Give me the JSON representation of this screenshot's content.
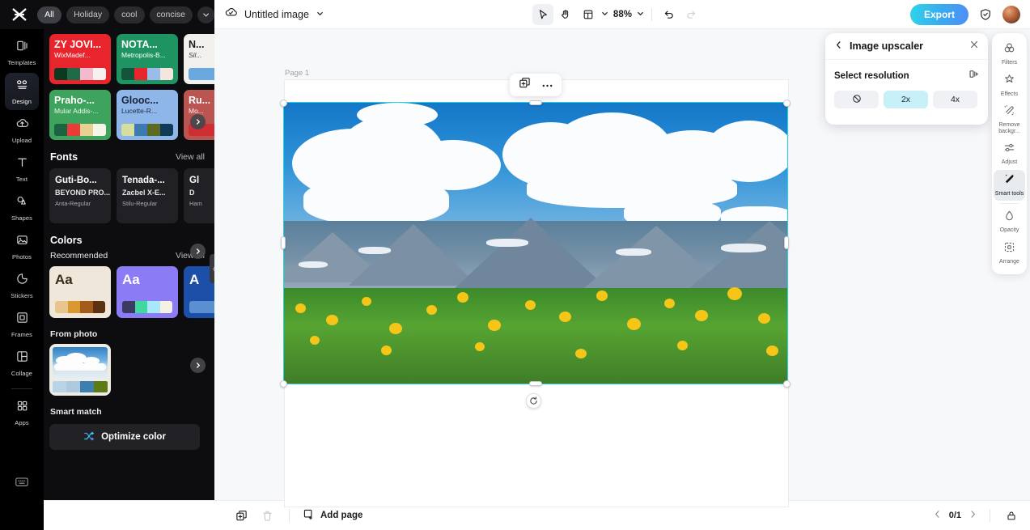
{
  "topbar": {
    "logo_icon": "capcut-logo-icon",
    "chips": [
      {
        "label": "All",
        "active": true
      },
      {
        "label": "Holiday",
        "active": false
      },
      {
        "label": "cool",
        "active": false
      },
      {
        "label": "concise",
        "active": false
      }
    ],
    "chip_more_icon": "chevron-down-icon",
    "cloud_icon": "cloud-saved-icon",
    "doc_title": "Untitled image",
    "doc_caret_icon": "chevron-down-icon",
    "tools": [
      {
        "name": "select-tool",
        "icon": "cursor-icon",
        "selected": true
      },
      {
        "name": "hand-tool",
        "icon": "hand-icon",
        "selected": false
      },
      {
        "name": "layout-tool",
        "icon": "layout-icon",
        "selected": false
      }
    ],
    "zoom_level": "88%",
    "undo_icon": "undo-icon",
    "redo_icon": "redo-icon",
    "export_label": "Export",
    "shield_icon": "shield-check-icon",
    "avatar_name": "user-avatar"
  },
  "rail": {
    "items": [
      {
        "label": "Templates",
        "icon": "templates-icon",
        "active": false
      },
      {
        "label": "Design",
        "icon": "design-icon",
        "active": true
      },
      {
        "label": "Upload",
        "icon": "upload-cloud-icon",
        "active": false
      },
      {
        "label": "Text",
        "icon": "text-icon",
        "active": false
      },
      {
        "label": "Shapes",
        "icon": "shapes-icon",
        "active": false
      },
      {
        "label": "Photos",
        "icon": "photos-icon",
        "active": false
      },
      {
        "label": "Stickers",
        "icon": "stickers-icon",
        "active": false
      },
      {
        "label": "Frames",
        "icon": "frames-icon",
        "active": false
      },
      {
        "label": "Collage",
        "icon": "collage-icon",
        "active": false
      },
      {
        "label": "Apps",
        "icon": "apps-grid-icon",
        "active": false
      }
    ],
    "bottom_icon": "keyboard-shortcuts-icon"
  },
  "panel": {
    "templates": [
      {
        "title": "ZY JOVI...",
        "subtitle": "WixMadef...",
        "bg": "#e8242c",
        "title_color": "#ffffff",
        "sub_color": "#ffffff",
        "swatches": [
          "#0c3a21",
          "#1f6b45",
          "#f4b9cd",
          "#f6f1ee"
        ]
      },
      {
        "title": "NOTA...",
        "subtitle": "Metropolis-B...",
        "bg": "#1f9463",
        "title_color": "#ffffff",
        "sub_color": "#ffffff",
        "swatches": [
          "#13553a",
          "#e8242c",
          "#9bbbe8",
          "#f4e6dc"
        ]
      },
      {
        "title": "N...",
        "subtitle": "Sil...",
        "bg": "#f2f0ec",
        "title_color": "#1c1c20",
        "sub_color": "#3a3a40",
        "swatches": [
          "#6aa9e0",
          "#6aa9e0",
          "#6aa9e0",
          "#6aa9e0"
        ]
      },
      {
        "title": "Praho-...",
        "subtitle": "Mular Addis-...",
        "bg": "#3da35d",
        "title_color": "#ffffff",
        "sub_color": "#eef6ee",
        "swatches": [
          "#1b6341",
          "#ea3b39",
          "#e8d190",
          "#f5f4e8"
        ]
      },
      {
        "title": "Glooc...",
        "subtitle": "Lucette-R...",
        "bg": "#8fb6e8",
        "title_color": "#16233c",
        "sub_color": "#1d2c48",
        "swatches": [
          "#d6dfa0",
          "#3d7ab2",
          "#5c6a22",
          "#123a56"
        ]
      },
      {
        "title": "Ru...",
        "subtitle": "Mo...",
        "bg": "#bb5552",
        "title_color": "#ffffff",
        "sub_color": "#ffeeee",
        "swatches": [
          "#cf2f33",
          "#cf2f33",
          "#cf2f33",
          "#cf2f33"
        ]
      }
    ],
    "fonts_section": {
      "title": "Fonts",
      "view_all": "View all"
    },
    "fonts": [
      {
        "line1": "Guti-Bo...",
        "line2": "BEYOND PRO...",
        "line3": "Anta-Regular"
      },
      {
        "line1": "Tenada-...",
        "line2": "Zacbel X-E...",
        "line3": "Stilu-Regular"
      },
      {
        "line1": "Gl",
        "line2": "D",
        "line3": "Ham"
      }
    ],
    "colors_section": {
      "title": "Colors",
      "sub": "Recommended",
      "view_all": "View all"
    },
    "colors": [
      {
        "sample": "Aa",
        "bg": "#efe7d9",
        "fg": "#3b2a17",
        "swatches": [
          "#e8c58f",
          "#d9992f",
          "#a35c19",
          "#5d3210"
        ]
      },
      {
        "sample": "Aa",
        "bg": "#8b7cf6",
        "fg": "#ffffff",
        "swatches": [
          "#3b3a63",
          "#3fd9a0",
          "#a9e8f8",
          "#f4f1e4"
        ]
      },
      {
        "sample": "A",
        "bg": "#1b4fa8",
        "fg": "#ffffff",
        "swatches": [
          "#5a8fd1",
          "#5a8fd1",
          "#5a8fd1",
          "#5a8fd1"
        ]
      }
    ],
    "from_photo_label": "From photo",
    "photo_swatches": [
      "#b9d4e6",
      "#aec8dd",
      "#3d7fae",
      "#5c7a15"
    ],
    "smart_match_label": "Smart match",
    "optimize_label": "Optimize color",
    "optimize_icon": "shuffle-icon",
    "next_arrow_icon": "chevron-right-icon",
    "collapse_icon": "panel-collapse-handle"
  },
  "canvas": {
    "page_label": "Page 1",
    "float_toolbar": [
      {
        "name": "duplicate-button",
        "icon": "duplicate-icon"
      },
      {
        "name": "more-options-button",
        "icon": "ellipsis-icon"
      }
    ],
    "rotate_icon": "rotate-handle-icon",
    "selection_color": "#23d3e0",
    "image_alt": "mountain meadow with yellow wildflowers and clouds"
  },
  "upscaler": {
    "back_icon": "chevron-left-icon",
    "title": "Image upscaler",
    "close_icon": "close-icon",
    "section_label": "Select resolution",
    "compare_icon": "compare-icon",
    "options": [
      {
        "label": "",
        "icon": "none-slash-icon",
        "selected": false
      },
      {
        "label": "2x",
        "icon": "",
        "selected": true
      },
      {
        "label": "4x",
        "icon": "",
        "selected": false
      }
    ]
  },
  "right_rail": {
    "items": [
      {
        "label": "Filters",
        "icon": "filters-icon",
        "active": false
      },
      {
        "label": "Effects",
        "icon": "effects-icon",
        "active": false
      },
      {
        "label": "Remove backgr...",
        "icon": "remove-background-icon",
        "active": false
      },
      {
        "label": "Adjust",
        "icon": "adjust-sliders-icon",
        "active": false
      },
      {
        "label": "Smart tools",
        "icon": "smart-tools-icon",
        "active": true
      },
      {
        "label": "Opacity",
        "icon": "opacity-icon",
        "active": false
      },
      {
        "label": "Arrange",
        "icon": "arrange-icon",
        "active": false
      }
    ]
  },
  "bottombar": {
    "duplicate_icon": "duplicate-page-icon",
    "delete_icon": "trash-icon",
    "add_page_label": "Add page",
    "add_page_icon": "add-page-icon",
    "prev_icon": "chevron-left-icon",
    "page_indicator": "0/1",
    "next_icon": "chevron-right-icon",
    "lock_icon": "lock-icon"
  }
}
